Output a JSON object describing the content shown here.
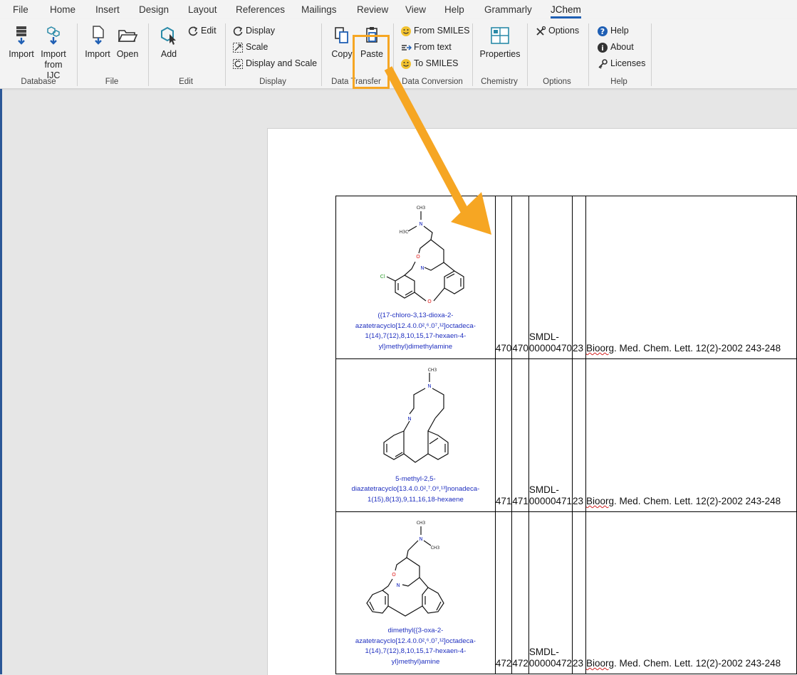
{
  "tabs": [
    "File",
    "Home",
    "Insert",
    "Design",
    "Layout",
    "References",
    "Mailings",
    "Review",
    "View",
    "Help",
    "Grammarly",
    "JChem"
  ],
  "active_tab": "JChem",
  "ribbon": {
    "database": {
      "label": "Database",
      "import": "Import",
      "import_ijc_1": "Import",
      "import_ijc_2": "from IJC"
    },
    "file": {
      "label": "File",
      "import": "Import",
      "open": "Open"
    },
    "edit": {
      "label": "Edit",
      "add": "Add",
      "edit": "Edit"
    },
    "display": {
      "label": "Display",
      "display": "Display",
      "scale": "Scale",
      "display_scale": "Display and Scale"
    },
    "data_transfer": {
      "label": "Data Transfer",
      "copy": "Copy",
      "paste": "Paste"
    },
    "data_conversion": {
      "label": "Data Conversion",
      "from_smiles": "From SMILES",
      "from_text": "From text",
      "to_smiles": "To SMILES"
    },
    "chemistry": {
      "label": "Chemistry",
      "properties": "Properties"
    },
    "options": {
      "label": "Options",
      "options": "Options"
    },
    "help": {
      "label": "Help",
      "help": "Help",
      "about": "About",
      "licenses": "Licenses"
    }
  },
  "colors": {
    "highlight": "#f6a623",
    "accent": "#1f5fb4",
    "molecule_name": "#1f2fbf"
  },
  "table": {
    "rows": [
      {
        "name_lines": [
          "({17-chloro-3,13-dioxa-2-",
          "azatetracyclo[12.4.0.0²,⁶.0⁷,¹²]octadeca-",
          "1(14),7(12),8,10,15,17-hexaen-4-",
          "yl}methyl)dimethylamine"
        ],
        "id1": "470",
        "id2": "470",
        "smdl_1": "SMDL-",
        "smdl_2": "00000470",
        "n": "23",
        "ref_word": "Bioorg",
        "ref_rest": ". Med. Chem. Lett. 12(2)-2002 243-248"
      },
      {
        "name_lines": [
          "5-methyl-2,5-",
          "diazatetracyclo[13.4.0.0²,⁷.0⁸,¹³]nonadeca-",
          "1(15),8(13),9,11,16,18-hexaene"
        ],
        "id1": "471",
        "id2": "471",
        "smdl_1": "SMDL-",
        "smdl_2": "00000471",
        "n": "23",
        "ref_word": "Bioorg",
        "ref_rest": ". Med. Chem. Lett. 12(2)-2002 243-248"
      },
      {
        "name_lines": [
          "dimethyl({3-oxa-2-",
          "azatetracyclo[12.4.0.0²,⁶.0⁷,¹²]octadeca-",
          "1(14),7(12),8,10,15,17-hexaen-4-",
          "yl}methyl)amine"
        ],
        "id1": "472",
        "id2": "472",
        "smdl_1": "SMDL-",
        "smdl_2": "00000472",
        "n": "23",
        "ref_word": "Bioorg",
        "ref_rest": ". Med. Chem. Lett. 12(2)-2002 243-248"
      }
    ]
  },
  "atoms": {
    "ch3": "CH3",
    "h3c": "H3C",
    "n": "N",
    "o": "O",
    "cl": "Cl",
    "ch3_sub": "3"
  }
}
